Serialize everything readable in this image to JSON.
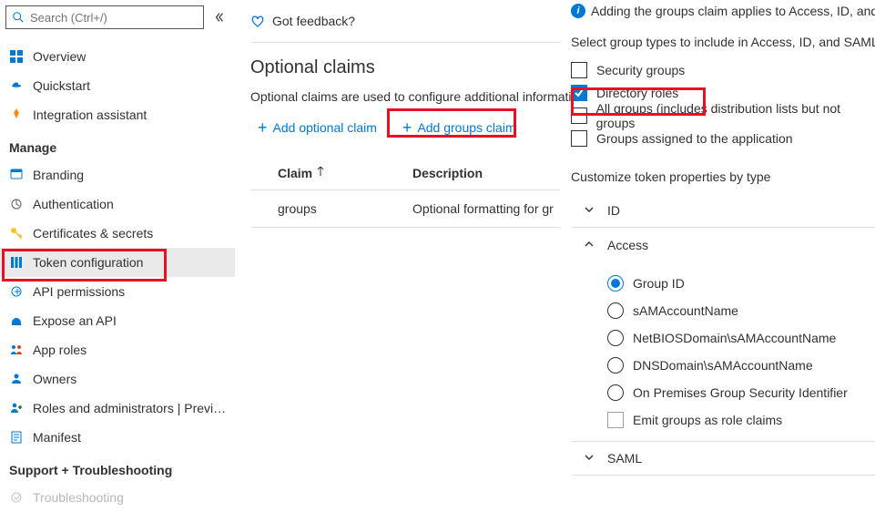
{
  "search": {
    "placeholder": "Search (Ctrl+/)"
  },
  "sidebar": {
    "overview": "Overview",
    "quickstart": "Quickstart",
    "integration_assistant": "Integration assistant",
    "manage_header": "Manage",
    "branding": "Branding",
    "authentication": "Authentication",
    "certificates": "Certificates & secrets",
    "token_configuration": "Token configuration",
    "api_permissions": "API permissions",
    "expose_api": "Expose an API",
    "app_roles": "App roles",
    "owners": "Owners",
    "roles_admins": "Roles and administrators | Previ…",
    "manifest": "Manifest",
    "support_header": "Support + Troubleshooting",
    "troubleshooting": "Troubleshooting"
  },
  "main": {
    "feedback": "Got feedback?",
    "title": "Optional claims",
    "description": "Optional claims are used to configure additional informati",
    "add_optional": "Add optional claim",
    "add_groups": "Add groups claim",
    "th_claim": "Claim",
    "th_description": "Description",
    "row_claim": "groups",
    "row_desc": "Optional formatting for gr"
  },
  "panel": {
    "info_text": "Adding the groups claim applies to Access, ID, and S",
    "select_label": "Select group types to include in Access, ID, and SAML t",
    "opts": {
      "security": "Security groups",
      "directory_roles": "Directory roles",
      "all_groups": "All groups (includes distribution lists but not groups",
      "app_groups": "Groups assigned to the application"
    },
    "customize_label": "Customize token properties by type",
    "sections": {
      "id": "ID",
      "access": "Access",
      "saml": "SAML"
    },
    "radios": {
      "group_id": "Group ID",
      "sam": "sAMAccountName",
      "netbios": "NetBIOSDomain\\sAMAccountName",
      "dns": "DNSDomain\\sAMAccountName",
      "onprem": "On Premises Group Security Identifier"
    },
    "emit_label": "Emit groups as role claims"
  }
}
